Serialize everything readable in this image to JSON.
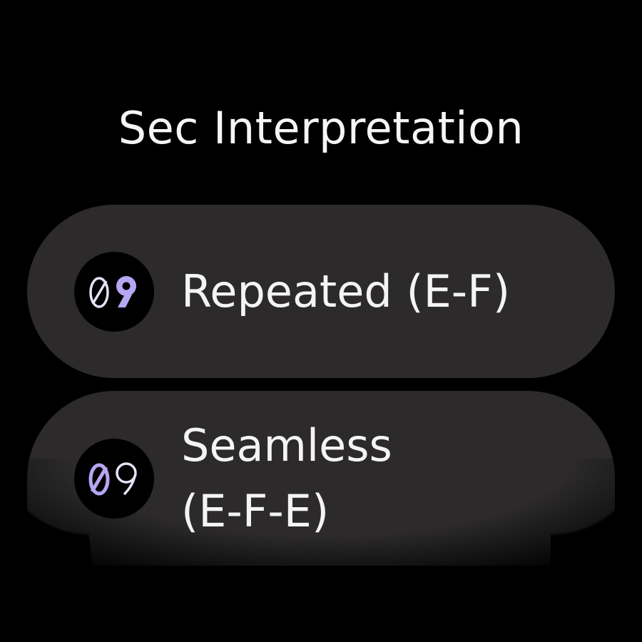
{
  "screen": {
    "title": "Sec Interpretation"
  },
  "options": [
    {
      "label": "Repeated (E-F)",
      "icon": "digits-09-icon",
      "icon_digit_left": "0",
      "icon_digit_right": "9"
    },
    {
      "label": "Seamless\n(E-F-E)",
      "icon": "digits-09-outline-icon",
      "icon_digit_left": "0",
      "icon_digit_right": "9"
    }
  ],
  "colors": {
    "background": "#000000",
    "chip": "#2c2a2a",
    "text": "#f4f4f4",
    "accent": "#b7a6f2"
  }
}
